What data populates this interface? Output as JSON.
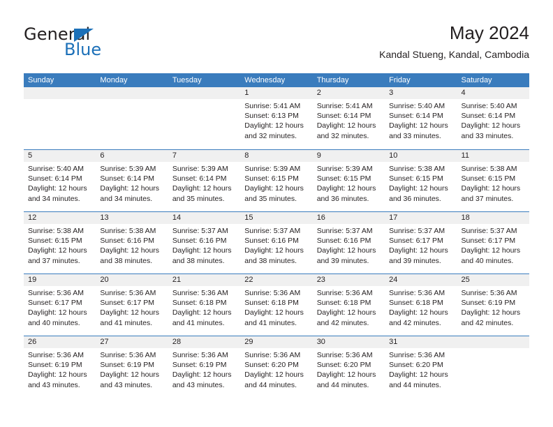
{
  "brand": {
    "word_one": "General",
    "word_two": "Blue",
    "triangle_color": "#1c70b8"
  },
  "header": {
    "title": "May 2024",
    "subtitle": "Kandal Stueng, Kandal, Cambodia"
  },
  "theme": {
    "header_blue": "#3a7cbd",
    "day_number_bg": "#f0f0f0",
    "text": "#231f20"
  },
  "weekdays": [
    "Sunday",
    "Monday",
    "Tuesday",
    "Wednesday",
    "Thursday",
    "Friday",
    "Saturday"
  ],
  "weeks": [
    [
      {
        "day": "",
        "lines": []
      },
      {
        "day": "",
        "lines": []
      },
      {
        "day": "",
        "lines": []
      },
      {
        "day": "1",
        "lines": [
          "Sunrise: 5:41 AM",
          "Sunset: 6:13 PM",
          "Daylight: 12 hours",
          "and 32 minutes."
        ]
      },
      {
        "day": "2",
        "lines": [
          "Sunrise: 5:41 AM",
          "Sunset: 6:14 PM",
          "Daylight: 12 hours",
          "and 32 minutes."
        ]
      },
      {
        "day": "3",
        "lines": [
          "Sunrise: 5:40 AM",
          "Sunset: 6:14 PM",
          "Daylight: 12 hours",
          "and 33 minutes."
        ]
      },
      {
        "day": "4",
        "lines": [
          "Sunrise: 5:40 AM",
          "Sunset: 6:14 PM",
          "Daylight: 12 hours",
          "and 33 minutes."
        ]
      }
    ],
    [
      {
        "day": "5",
        "lines": [
          "Sunrise: 5:40 AM",
          "Sunset: 6:14 PM",
          "Daylight: 12 hours",
          "and 34 minutes."
        ]
      },
      {
        "day": "6",
        "lines": [
          "Sunrise: 5:39 AM",
          "Sunset: 6:14 PM",
          "Daylight: 12 hours",
          "and 34 minutes."
        ]
      },
      {
        "day": "7",
        "lines": [
          "Sunrise: 5:39 AM",
          "Sunset: 6:14 PM",
          "Daylight: 12 hours",
          "and 35 minutes."
        ]
      },
      {
        "day": "8",
        "lines": [
          "Sunrise: 5:39 AM",
          "Sunset: 6:15 PM",
          "Daylight: 12 hours",
          "and 35 minutes."
        ]
      },
      {
        "day": "9",
        "lines": [
          "Sunrise: 5:39 AM",
          "Sunset: 6:15 PM",
          "Daylight: 12 hours",
          "and 36 minutes."
        ]
      },
      {
        "day": "10",
        "lines": [
          "Sunrise: 5:38 AM",
          "Sunset: 6:15 PM",
          "Daylight: 12 hours",
          "and 36 minutes."
        ]
      },
      {
        "day": "11",
        "lines": [
          "Sunrise: 5:38 AM",
          "Sunset: 6:15 PM",
          "Daylight: 12 hours",
          "and 37 minutes."
        ]
      }
    ],
    [
      {
        "day": "12",
        "lines": [
          "Sunrise: 5:38 AM",
          "Sunset: 6:15 PM",
          "Daylight: 12 hours",
          "and 37 minutes."
        ]
      },
      {
        "day": "13",
        "lines": [
          "Sunrise: 5:38 AM",
          "Sunset: 6:16 PM",
          "Daylight: 12 hours",
          "and 38 minutes."
        ]
      },
      {
        "day": "14",
        "lines": [
          "Sunrise: 5:37 AM",
          "Sunset: 6:16 PM",
          "Daylight: 12 hours",
          "and 38 minutes."
        ]
      },
      {
        "day": "15",
        "lines": [
          "Sunrise: 5:37 AM",
          "Sunset: 6:16 PM",
          "Daylight: 12 hours",
          "and 38 minutes."
        ]
      },
      {
        "day": "16",
        "lines": [
          "Sunrise: 5:37 AM",
          "Sunset: 6:16 PM",
          "Daylight: 12 hours",
          "and 39 minutes."
        ]
      },
      {
        "day": "17",
        "lines": [
          "Sunrise: 5:37 AM",
          "Sunset: 6:17 PM",
          "Daylight: 12 hours",
          "and 39 minutes."
        ]
      },
      {
        "day": "18",
        "lines": [
          "Sunrise: 5:37 AM",
          "Sunset: 6:17 PM",
          "Daylight: 12 hours",
          "and 40 minutes."
        ]
      }
    ],
    [
      {
        "day": "19",
        "lines": [
          "Sunrise: 5:36 AM",
          "Sunset: 6:17 PM",
          "Daylight: 12 hours",
          "and 40 minutes."
        ]
      },
      {
        "day": "20",
        "lines": [
          "Sunrise: 5:36 AM",
          "Sunset: 6:17 PM",
          "Daylight: 12 hours",
          "and 41 minutes."
        ]
      },
      {
        "day": "21",
        "lines": [
          "Sunrise: 5:36 AM",
          "Sunset: 6:18 PM",
          "Daylight: 12 hours",
          "and 41 minutes."
        ]
      },
      {
        "day": "22",
        "lines": [
          "Sunrise: 5:36 AM",
          "Sunset: 6:18 PM",
          "Daylight: 12 hours",
          "and 41 minutes."
        ]
      },
      {
        "day": "23",
        "lines": [
          "Sunrise: 5:36 AM",
          "Sunset: 6:18 PM",
          "Daylight: 12 hours",
          "and 42 minutes."
        ]
      },
      {
        "day": "24",
        "lines": [
          "Sunrise: 5:36 AM",
          "Sunset: 6:18 PM",
          "Daylight: 12 hours",
          "and 42 minutes."
        ]
      },
      {
        "day": "25",
        "lines": [
          "Sunrise: 5:36 AM",
          "Sunset: 6:19 PM",
          "Daylight: 12 hours",
          "and 42 minutes."
        ]
      }
    ],
    [
      {
        "day": "26",
        "lines": [
          "Sunrise: 5:36 AM",
          "Sunset: 6:19 PM",
          "Daylight: 12 hours",
          "and 43 minutes."
        ]
      },
      {
        "day": "27",
        "lines": [
          "Sunrise: 5:36 AM",
          "Sunset: 6:19 PM",
          "Daylight: 12 hours",
          "and 43 minutes."
        ]
      },
      {
        "day": "28",
        "lines": [
          "Sunrise: 5:36 AM",
          "Sunset: 6:19 PM",
          "Daylight: 12 hours",
          "and 43 minutes."
        ]
      },
      {
        "day": "29",
        "lines": [
          "Sunrise: 5:36 AM",
          "Sunset: 6:20 PM",
          "Daylight: 12 hours",
          "and 44 minutes."
        ]
      },
      {
        "day": "30",
        "lines": [
          "Sunrise: 5:36 AM",
          "Sunset: 6:20 PM",
          "Daylight: 12 hours",
          "and 44 minutes."
        ]
      },
      {
        "day": "31",
        "lines": [
          "Sunrise: 5:36 AM",
          "Sunset: 6:20 PM",
          "Daylight: 12 hours",
          "and 44 minutes."
        ]
      },
      {
        "day": "",
        "lines": []
      }
    ]
  ]
}
